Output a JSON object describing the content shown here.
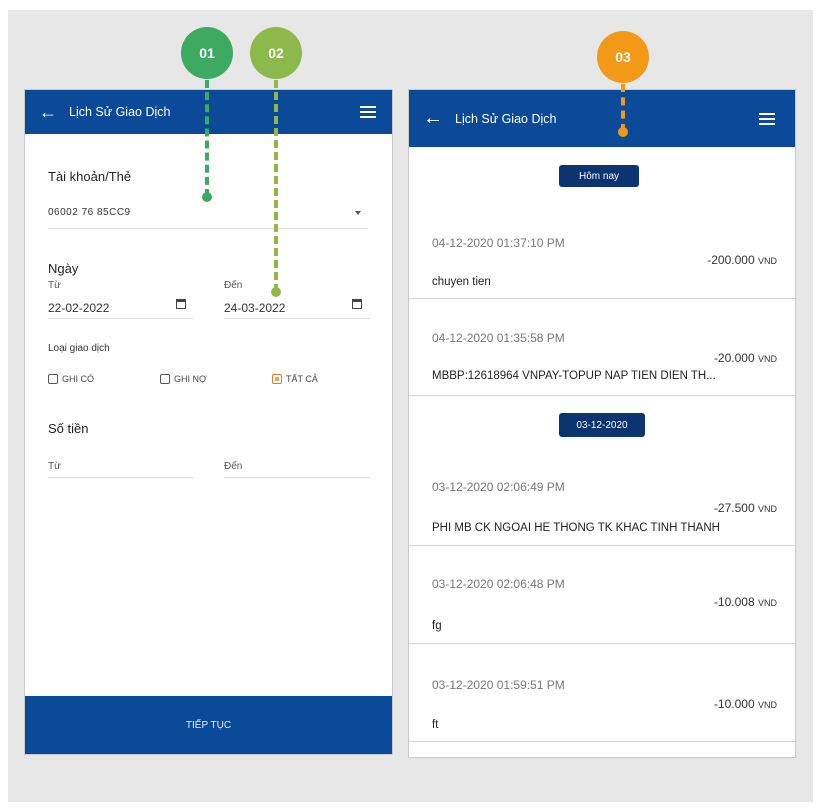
{
  "markers": [
    "01",
    "02",
    "03"
  ],
  "colors": {
    "marker_01": "#3caa61",
    "marker_02": "#8db84c",
    "marker_03": "#f29a17",
    "appbar": "#0a4a98",
    "chip": "#0c3470"
  },
  "left_screen": {
    "title": "Lịch Sử Giao Dịch",
    "account_label": "Tài khoản/Thẻ",
    "account_value": "06002 76 85CC9",
    "date_section": "Ngày",
    "from_label": "Từ",
    "from_date": "22-02-2022",
    "to_label": "Đến",
    "to_date": "24-03-2022",
    "tx_type_label": "Loại giao dịch",
    "options": [
      "GHI CÓ",
      "GHI NỢ",
      "TẤT CẢ"
    ],
    "selected_option": "TẤT CẢ",
    "amount_section": "Số tiền",
    "amount_from": "Từ",
    "amount_to": "Đến",
    "continue_button": "TIẾP TỤC"
  },
  "right_screen": {
    "title": "Lịch Sử Giao Dịch",
    "groups": [
      {
        "label": "Hôm nay",
        "items": [
          {
            "time": "04-12-2020 01:37:10 PM",
            "amount": "-200.000",
            "currency": "VND",
            "description": "chuyen tien"
          },
          {
            "time": "04-12-2020 01:35:58 PM",
            "amount": "-20.000",
            "currency": "VND",
            "description": "MBBP:12618964 VNPAY-TOPUP NAP TIEN DIEN TH..."
          }
        ]
      },
      {
        "label": "03-12-2020",
        "items": [
          {
            "time": "03-12-2020 02:06:49 PM",
            "amount": "-27.500",
            "currency": "VND",
            "description": "PHI MB CK NGOAI HE THONG TK KHAC TINH THANH"
          },
          {
            "time": "03-12-2020 02:06:48 PM",
            "amount": "-10.008",
            "currency": "VND",
            "description": "fg"
          },
          {
            "time": "03-12-2020 01:59:51 PM",
            "amount": "-10.000",
            "currency": "VND",
            "description": "ft"
          }
        ]
      }
    ]
  }
}
